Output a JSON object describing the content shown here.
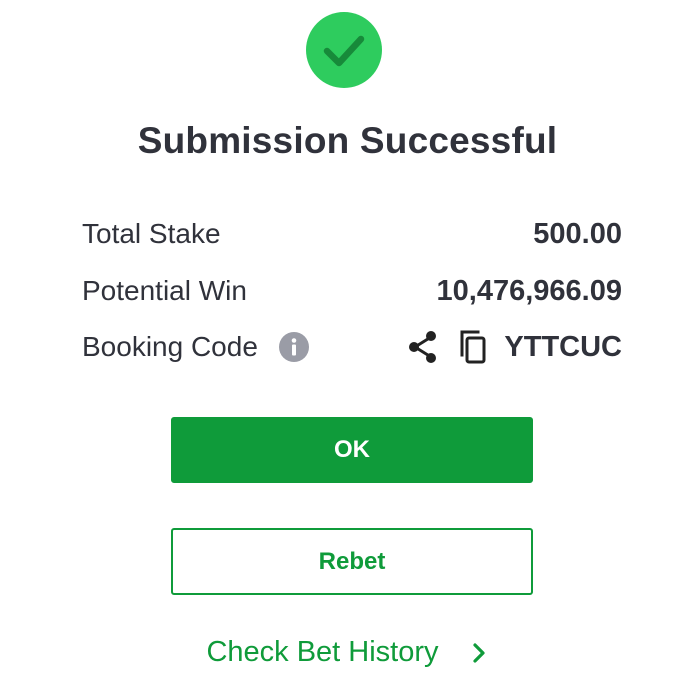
{
  "header": {
    "title": "Submission Successful",
    "icon": "check-circle-icon",
    "icon_color": "#2ecc5e"
  },
  "summary": {
    "total_stake_label": "Total Stake",
    "total_stake_value": "500.00",
    "potential_win_label": "Potential Win",
    "potential_win_value": "10,476,966.09",
    "booking_code_label": "Booking Code",
    "booking_code_value": "YTTCUC"
  },
  "actions": {
    "ok_label": "OK",
    "rebet_label": "Rebet",
    "history_label": "Check Bet History"
  },
  "colors": {
    "primary_green": "#0f9b3a",
    "text_dark": "#30323b",
    "info_grey": "#9a9ca6"
  }
}
